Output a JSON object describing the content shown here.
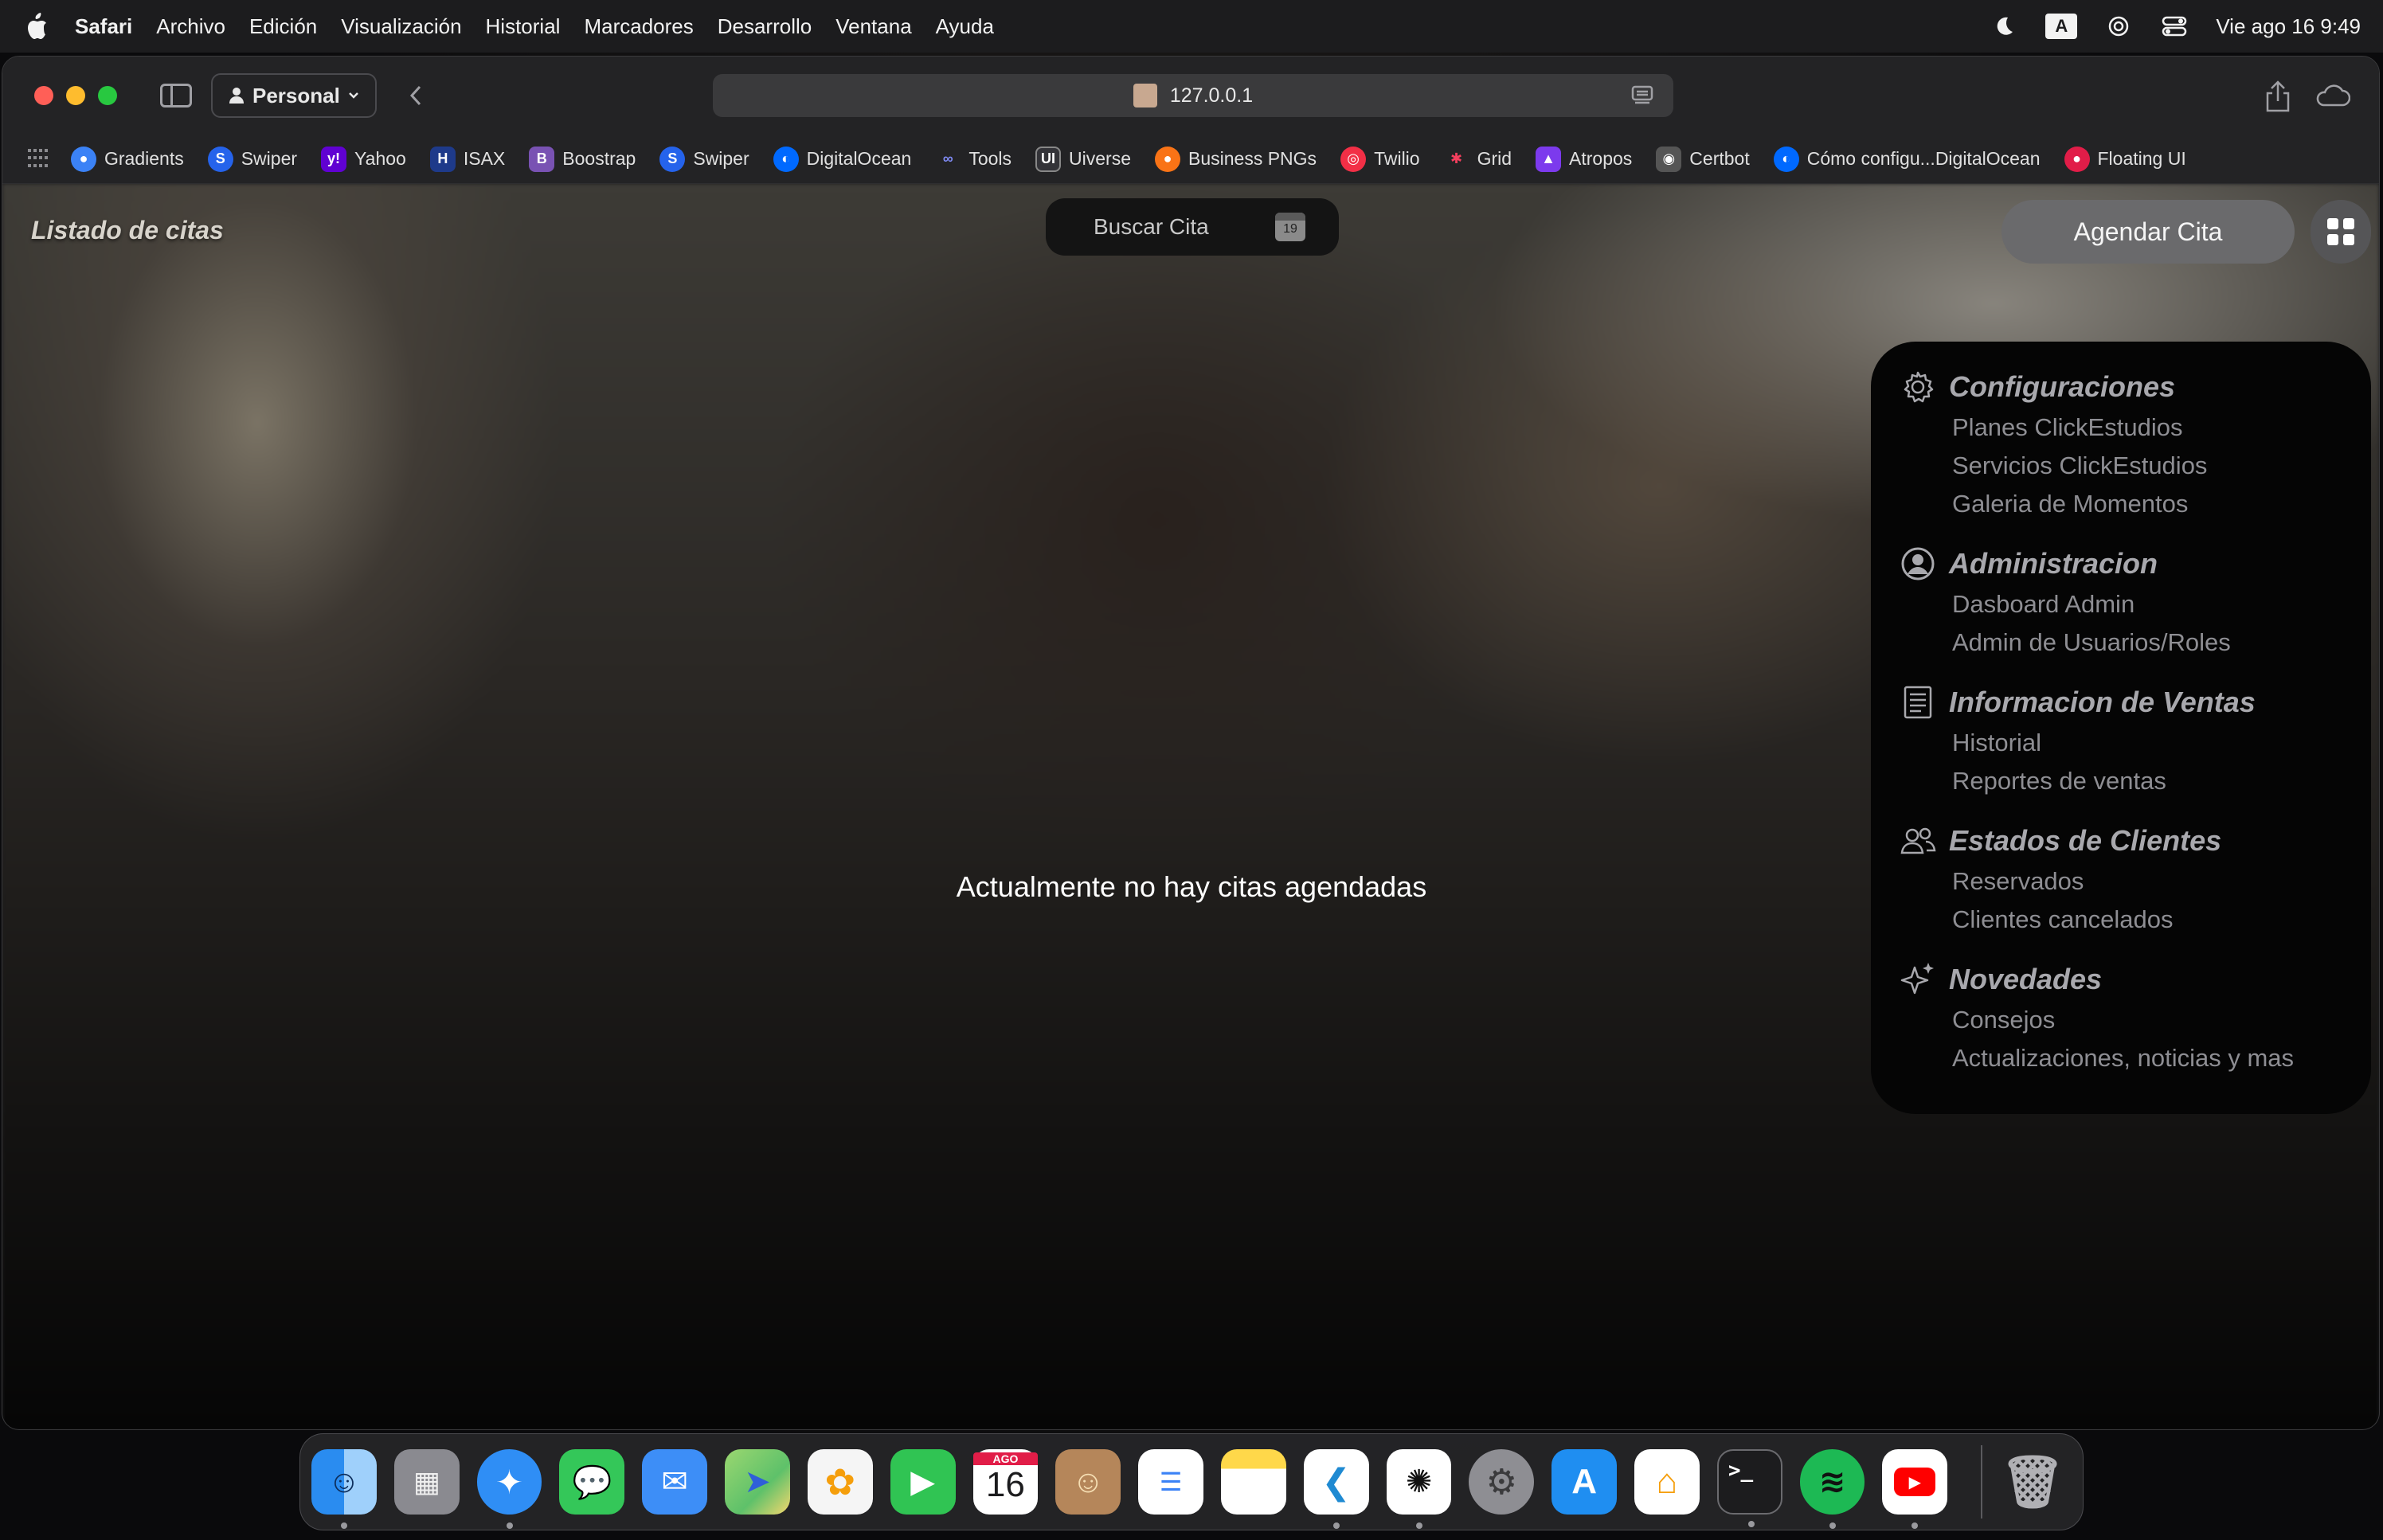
{
  "menubar": {
    "app_name": "Safari",
    "items": [
      "Archivo",
      "Edición",
      "Visualización",
      "Historial",
      "Marcadores",
      "Desarrollo",
      "Ventana",
      "Ayuda"
    ],
    "input_source": "A",
    "clock": "Vie ago 16  9:49"
  },
  "toolbar": {
    "profile": "Personal",
    "url": "127.0.0.1"
  },
  "favorites": [
    {
      "label": "Gradients",
      "icon": "gradients-icon",
      "color": "#3b82f6"
    },
    {
      "label": "Swiper",
      "icon": "swiper-icon",
      "color": "#2563eb"
    },
    {
      "label": "Yahoo",
      "icon": "yahoo-icon",
      "color": "#6001d2"
    },
    {
      "label": "ISAX",
      "icon": "isax-icon",
      "color": "#3b82f6"
    },
    {
      "label": "Boostrap",
      "icon": "bootstrap-icon",
      "color": "#7952b3"
    },
    {
      "label": "Swiper",
      "icon": "swiper-icon",
      "color": "#2563eb"
    },
    {
      "label": "DigitalOcean",
      "icon": "digitalocean-icon",
      "color": "#0069ff"
    },
    {
      "label": "Tools",
      "icon": "tools-icon",
      "color": "#4f46e5"
    },
    {
      "label": "Uiverse",
      "icon": "uiverse-icon",
      "color": "#333338"
    },
    {
      "label": "Business PNGs",
      "icon": "business-pngs-icon",
      "color": "#f97316"
    },
    {
      "label": "Twilio",
      "icon": "twilio-icon",
      "color": "#f22f46"
    },
    {
      "label": "Grid",
      "icon": "grid-icon",
      "color": "#e11d48"
    },
    {
      "label": "Atropos",
      "icon": "atropos-icon",
      "color": "#7c3aed"
    },
    {
      "label": "Certbot",
      "icon": "certbot-icon",
      "color": "#555555"
    },
    {
      "label": "Cómo configu...DigitalOcean",
      "icon": "digitalocean-icon",
      "color": "#0069ff"
    },
    {
      "label": "Floating UI",
      "icon": "floating-ui-icon",
      "color": "#e11d48"
    }
  ],
  "page": {
    "title": "Listado de citas",
    "search_label": "Buscar Cita",
    "calendar_day": "19",
    "agendar_label": "Agendar Cita",
    "empty_message": "Actualmente no hay citas agendadas"
  },
  "menu": {
    "sections": [
      {
        "title": "Configuraciones",
        "icon": "gear-icon",
        "items": [
          "Planes ClickEstudios",
          "Servicios ClickEstudios",
          "Galeria de Momentos"
        ]
      },
      {
        "title": "Administracion",
        "icon": "user-circle-icon",
        "items": [
          "Dasboard Admin",
          "Admin de Usuarios/Roles"
        ]
      },
      {
        "title": "Informacion de Ventas",
        "icon": "receipt-icon",
        "items": [
          "Historial",
          "Reportes de ventas"
        ]
      },
      {
        "title": "Estados de Clientes",
        "icon": "users-icon",
        "items": [
          "Reservados",
          "Clientes cancelados"
        ]
      },
      {
        "title": "Novedades",
        "icon": "sparkles-icon",
        "items": [
          "Consejos",
          "Actualizaciones, noticias y mas"
        ]
      }
    ]
  },
  "dock": {
    "apps": [
      {
        "name": "finder",
        "color": "#3a9cf2",
        "running": true
      },
      {
        "name": "launchpad",
        "color": "#8a8a90",
        "running": false
      },
      {
        "name": "safari",
        "color": "#2f8ef5",
        "running": true
      },
      {
        "name": "messages",
        "color": "#34c759",
        "running": false
      },
      {
        "name": "mail",
        "color": "#3d8ef7",
        "running": false
      },
      {
        "name": "maps",
        "color": "#5ec16a",
        "running": false
      },
      {
        "name": "photos",
        "color": "#f5f5f5",
        "running": false
      },
      {
        "name": "facetime",
        "color": "#30c453",
        "running": false
      },
      {
        "name": "calendar",
        "color": "#ffffff",
        "running": false,
        "month": "AGO",
        "day": "16"
      },
      {
        "name": "contacts",
        "color": "#b5865a",
        "running": false
      },
      {
        "name": "reminders",
        "color": "#ffffff",
        "running": false
      },
      {
        "name": "notes",
        "color": "#ffe27a",
        "running": false
      },
      {
        "name": "vscode",
        "color": "#ffffff",
        "running": true
      },
      {
        "name": "chatgpt",
        "color": "#ffffff",
        "running": true
      },
      {
        "name": "system-settings",
        "color": "#8e8e93",
        "running": false
      },
      {
        "name": "app-store",
        "color": "#1f8ef1",
        "running": false
      },
      {
        "name": "home",
        "color": "#ffffff",
        "running": false
      },
      {
        "name": "terminal",
        "color": "#1c1c1e",
        "running": true
      },
      {
        "name": "spotify",
        "color": "#1db954",
        "running": true
      },
      {
        "name": "youtube",
        "color": "#ffffff",
        "running": true
      }
    ],
    "trash": "trash"
  }
}
